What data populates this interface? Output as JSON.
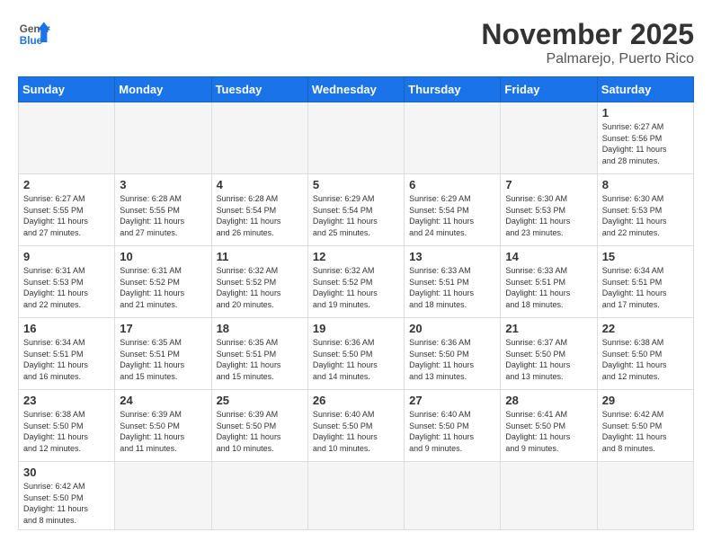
{
  "header": {
    "logo_general": "General",
    "logo_blue": "Blue",
    "month_title": "November 2025",
    "location": "Palmarejo, Puerto Rico"
  },
  "days_of_week": [
    "Sunday",
    "Monday",
    "Tuesday",
    "Wednesday",
    "Thursday",
    "Friday",
    "Saturday"
  ],
  "weeks": [
    [
      {
        "day": "",
        "info": ""
      },
      {
        "day": "",
        "info": ""
      },
      {
        "day": "",
        "info": ""
      },
      {
        "day": "",
        "info": ""
      },
      {
        "day": "",
        "info": ""
      },
      {
        "day": "",
        "info": ""
      },
      {
        "day": "1",
        "info": "Sunrise: 6:27 AM\nSunset: 5:56 PM\nDaylight: 11 hours\nand 28 minutes."
      }
    ],
    [
      {
        "day": "2",
        "info": "Sunrise: 6:27 AM\nSunset: 5:55 PM\nDaylight: 11 hours\nand 27 minutes."
      },
      {
        "day": "3",
        "info": "Sunrise: 6:28 AM\nSunset: 5:55 PM\nDaylight: 11 hours\nand 27 minutes."
      },
      {
        "day": "4",
        "info": "Sunrise: 6:28 AM\nSunset: 5:54 PM\nDaylight: 11 hours\nand 26 minutes."
      },
      {
        "day": "5",
        "info": "Sunrise: 6:29 AM\nSunset: 5:54 PM\nDaylight: 11 hours\nand 25 minutes."
      },
      {
        "day": "6",
        "info": "Sunrise: 6:29 AM\nSunset: 5:54 PM\nDaylight: 11 hours\nand 24 minutes."
      },
      {
        "day": "7",
        "info": "Sunrise: 6:30 AM\nSunset: 5:53 PM\nDaylight: 11 hours\nand 23 minutes."
      },
      {
        "day": "8",
        "info": "Sunrise: 6:30 AM\nSunset: 5:53 PM\nDaylight: 11 hours\nand 22 minutes."
      }
    ],
    [
      {
        "day": "9",
        "info": "Sunrise: 6:31 AM\nSunset: 5:53 PM\nDaylight: 11 hours\nand 22 minutes."
      },
      {
        "day": "10",
        "info": "Sunrise: 6:31 AM\nSunset: 5:52 PM\nDaylight: 11 hours\nand 21 minutes."
      },
      {
        "day": "11",
        "info": "Sunrise: 6:32 AM\nSunset: 5:52 PM\nDaylight: 11 hours\nand 20 minutes."
      },
      {
        "day": "12",
        "info": "Sunrise: 6:32 AM\nSunset: 5:52 PM\nDaylight: 11 hours\nand 19 minutes."
      },
      {
        "day": "13",
        "info": "Sunrise: 6:33 AM\nSunset: 5:51 PM\nDaylight: 11 hours\nand 18 minutes."
      },
      {
        "day": "14",
        "info": "Sunrise: 6:33 AM\nSunset: 5:51 PM\nDaylight: 11 hours\nand 18 minutes."
      },
      {
        "day": "15",
        "info": "Sunrise: 6:34 AM\nSunset: 5:51 PM\nDaylight: 11 hours\nand 17 minutes."
      }
    ],
    [
      {
        "day": "16",
        "info": "Sunrise: 6:34 AM\nSunset: 5:51 PM\nDaylight: 11 hours\nand 16 minutes."
      },
      {
        "day": "17",
        "info": "Sunrise: 6:35 AM\nSunset: 5:51 PM\nDaylight: 11 hours\nand 15 minutes."
      },
      {
        "day": "18",
        "info": "Sunrise: 6:35 AM\nSunset: 5:51 PM\nDaylight: 11 hours\nand 15 minutes."
      },
      {
        "day": "19",
        "info": "Sunrise: 6:36 AM\nSunset: 5:50 PM\nDaylight: 11 hours\nand 14 minutes."
      },
      {
        "day": "20",
        "info": "Sunrise: 6:36 AM\nSunset: 5:50 PM\nDaylight: 11 hours\nand 13 minutes."
      },
      {
        "day": "21",
        "info": "Sunrise: 6:37 AM\nSunset: 5:50 PM\nDaylight: 11 hours\nand 13 minutes."
      },
      {
        "day": "22",
        "info": "Sunrise: 6:38 AM\nSunset: 5:50 PM\nDaylight: 11 hours\nand 12 minutes."
      }
    ],
    [
      {
        "day": "23",
        "info": "Sunrise: 6:38 AM\nSunset: 5:50 PM\nDaylight: 11 hours\nand 12 minutes."
      },
      {
        "day": "24",
        "info": "Sunrise: 6:39 AM\nSunset: 5:50 PM\nDaylight: 11 hours\nand 11 minutes."
      },
      {
        "day": "25",
        "info": "Sunrise: 6:39 AM\nSunset: 5:50 PM\nDaylight: 11 hours\nand 10 minutes."
      },
      {
        "day": "26",
        "info": "Sunrise: 6:40 AM\nSunset: 5:50 PM\nDaylight: 11 hours\nand 10 minutes."
      },
      {
        "day": "27",
        "info": "Sunrise: 6:40 AM\nSunset: 5:50 PM\nDaylight: 11 hours\nand 9 minutes."
      },
      {
        "day": "28",
        "info": "Sunrise: 6:41 AM\nSunset: 5:50 PM\nDaylight: 11 hours\nand 9 minutes."
      },
      {
        "day": "29",
        "info": "Sunrise: 6:42 AM\nSunset: 5:50 PM\nDaylight: 11 hours\nand 8 minutes."
      }
    ],
    [
      {
        "day": "30",
        "info": "Sunrise: 6:42 AM\nSunset: 5:50 PM\nDaylight: 11 hours\nand 8 minutes."
      },
      {
        "day": "",
        "info": ""
      },
      {
        "day": "",
        "info": ""
      },
      {
        "day": "",
        "info": ""
      },
      {
        "day": "",
        "info": ""
      },
      {
        "day": "",
        "info": ""
      },
      {
        "day": "",
        "info": ""
      }
    ]
  ]
}
